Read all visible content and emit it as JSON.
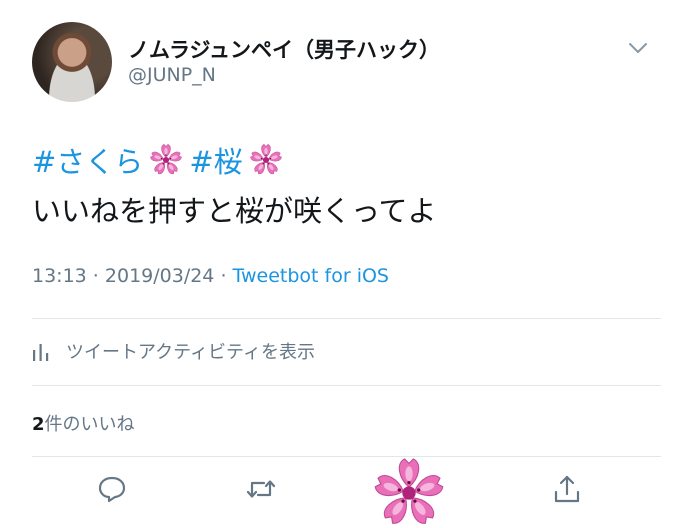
{
  "author": {
    "name": "ノムラジュンペイ（男子ハック）",
    "handle": "@JUNP_N",
    "avatar_icon": "profile-photo"
  },
  "tweet": {
    "hashtag1": "#さくら",
    "hashtag2": "#桜",
    "emoji_icon": "cherry-blossom-emoji",
    "body": "いいねを押すと桜が咲くってよ"
  },
  "meta": {
    "time": "13:13",
    "separator": " · ",
    "date": "2019/03/24",
    "client": "Tweetbot for iOS"
  },
  "activity": {
    "label": "ツイートアクティビティを表示",
    "icon": "bar-chart-icon"
  },
  "likes": {
    "count": "2",
    "label": "件のいいね"
  },
  "actions": {
    "reply_icon": "reply-icon",
    "retweet_icon": "retweet-icon",
    "like_icon": "cherry-blossom-like-icon",
    "share_icon": "share-icon"
  },
  "colors": {
    "link": "#1b95e0",
    "secondary_text": "#657786",
    "primary_text": "#14171a",
    "divider": "#e1e8ed",
    "blossom": "#e86fb8"
  }
}
